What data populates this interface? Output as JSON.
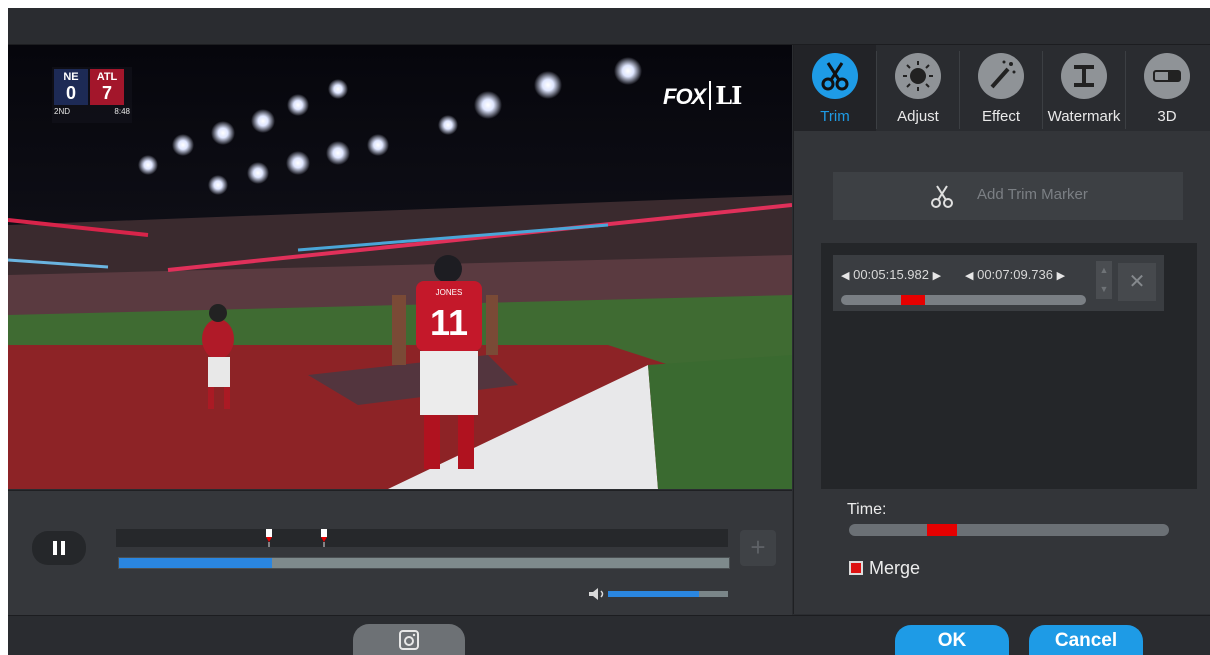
{
  "scoreboard": {
    "home_abbr": "NE",
    "home_score": "0",
    "away_abbr": "ATL",
    "away_score": "7",
    "quarter": "2ND",
    "clock": "8:48"
  },
  "broadcast": {
    "network": "FOX",
    "logo": "LI"
  },
  "player": {
    "name": "JONES",
    "number": "11"
  },
  "player_controls": {
    "play_state": "paused-icon",
    "progress_fraction": 0.25,
    "volume_fraction": 0.76,
    "trim_markers_fraction": [
      0.25,
      0.34
    ]
  },
  "tabs": [
    {
      "label": "Trim",
      "icon": "scissors-icon",
      "active": true
    },
    {
      "label": "Adjust",
      "icon": "brightness-icon",
      "active": false
    },
    {
      "label": "Effect",
      "icon": "magic-wand-icon",
      "active": false
    },
    {
      "label": "Watermark",
      "icon": "watermark-icon",
      "active": false
    },
    {
      "label": "3D",
      "icon": "3d-glasses-icon",
      "active": false
    }
  ],
  "trim": {
    "add_marker_label": "Add Trim Marker",
    "segment": {
      "start": "00:05:15.982",
      "end": "00:07:09.736"
    },
    "time_label": "Time:",
    "merge_label": "Merge",
    "merge_checked": true
  },
  "footer": {
    "ok_label": "OK",
    "cancel_label": "Cancel"
  },
  "colors": {
    "accent": "#1e9be6",
    "marker_red": "#e60000",
    "panel": "#333539"
  }
}
